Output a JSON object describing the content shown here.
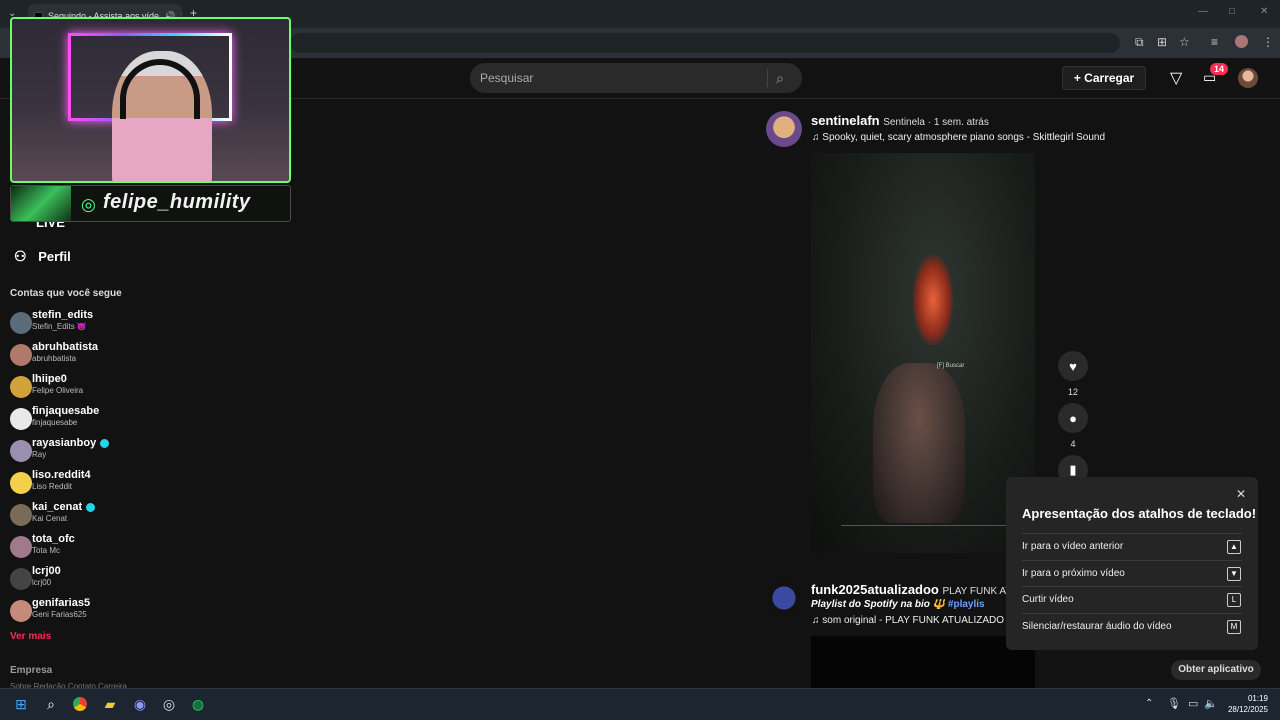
{
  "browser": {
    "tab_title": "Seguindo - Assista aos víde",
    "tab_close": "✕",
    "new_tab": "+",
    "window_min": "—",
    "window_max": "□",
    "window_close": "✕"
  },
  "header": {
    "search_placeholder": "Pesquisar",
    "upload_label": "+ Carregar",
    "inbox_badge": "14"
  },
  "sidebar": {
    "live_label": "LIVE",
    "profile_label": "Perfil",
    "following_title": "Contas que você segue",
    "accounts": [
      {
        "username": "stefin_edits",
        "display": "Stefin_Edits 😈",
        "verified": false,
        "color": "#5a6b7a"
      },
      {
        "username": "abruhbatista",
        "display": "abruhbatista",
        "verified": false,
        "color": "#b07a6a"
      },
      {
        "username": "lhiipe0",
        "display": "Felipe Oliveira",
        "verified": false,
        "color": "#d2a23a"
      },
      {
        "username": "finjaquesabe",
        "display": "finjaquesabe",
        "verified": false,
        "color": "#e9e9e9"
      },
      {
        "username": "rayasianboy",
        "display": "Ray",
        "verified": true,
        "color": "#9a8fb0"
      },
      {
        "username": "liso.reddit4",
        "display": "Liso Reddit",
        "verified": false,
        "color": "#f2d04a"
      },
      {
        "username": "kai_cenat",
        "display": "Kai Cenat",
        "verified": true,
        "color": "#7a6a5a"
      },
      {
        "username": "tota_ofc",
        "display": "Tota Mc",
        "verified": false,
        "color": "#a07a8a"
      },
      {
        "username": "lcrj00",
        "display": "lcrj00",
        "verified": false,
        "color": "#444"
      },
      {
        "username": "genifarias5",
        "display": "Geni Farias625",
        "verified": false,
        "color": "#c48a7a"
      }
    ],
    "see_more": "Ver mais",
    "company_title": "Empresa",
    "footer_links": "Sobre  Redação  Contato  Carreira"
  },
  "overlay": {
    "instagram_handle": "felipe_humility"
  },
  "posts": [
    {
      "username": "sentinelafn",
      "meta": "Sentinela · 1 sem. atrás",
      "music": "♫ Spooky, quiet, scary atmosphere piano songs - Skittlegirl Sound",
      "hud_text": "[F] Buscar",
      "likes": "12",
      "comments": "4"
    },
    {
      "username": "funk2025atualizadoo",
      "meta": "PLAY FUNK ATU",
      "caption": "Playlist do Spotify na bio 🔱 ",
      "hashtag": "#playlis",
      "music": "♫ som original - PLAY FUNK ATUALIZADO 🔱"
    }
  ],
  "shortcuts": {
    "title": "Apresentação dos atalhos de teclado!",
    "close": "✕",
    "rows": [
      {
        "label": "Ir para o vídeo anterior",
        "key": "▲"
      },
      {
        "label": "Ir para o próximo vídeo",
        "key": "▼"
      },
      {
        "label": "Curtir vídeo",
        "key": "L"
      },
      {
        "label": "Silenciar/restaurar áudio do vídeo",
        "key": "M"
      }
    ]
  },
  "get_app": "Obter aplicativo",
  "taskbar": {
    "time": "01:19",
    "date": "28/12/2025"
  },
  "colors": {
    "accent": "#fe2c55",
    "verified": "#20d5ec",
    "background": "#121212"
  }
}
